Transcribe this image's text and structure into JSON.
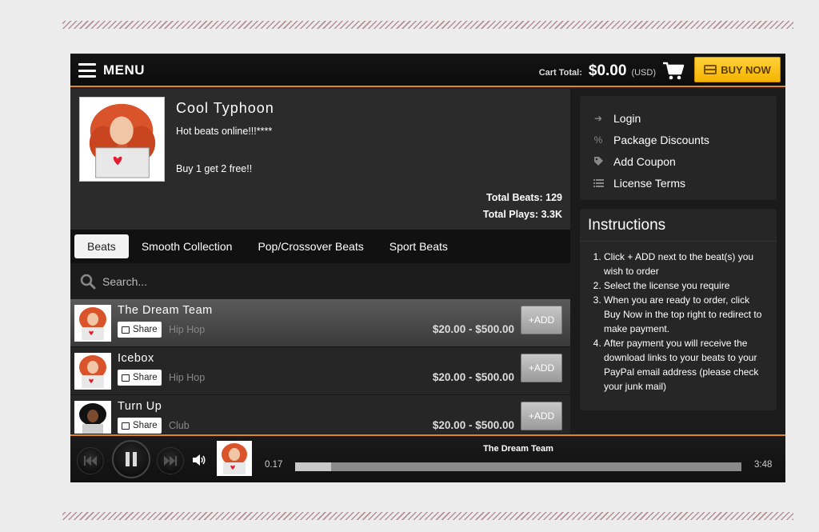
{
  "header": {
    "menu_label": "MENU",
    "cart_total_label": "Cart Total:",
    "cart_total_amount": "$0.00",
    "cart_currency": "(USD)",
    "buy_now_label": "BUY NOW",
    "accent_color": "#e0861e"
  },
  "profile": {
    "name": "Cool Typhoon",
    "bio_line1": "Hot beats online!!!****",
    "bio_line2": "Buy 1 get 2 free!!",
    "total_beats": "Total Beats: 129",
    "total_plays": "Total Plays: 3.3K"
  },
  "tabs": [
    {
      "label": "Beats",
      "active": true
    },
    {
      "label": "Smooth Collection",
      "active": false
    },
    {
      "label": "Pop/Crossover Beats",
      "active": false
    },
    {
      "label": "Sport Beats",
      "active": false
    }
  ],
  "search": {
    "placeholder": "Search..."
  },
  "tracks": [
    {
      "title": "The Dream Team",
      "share_label": "Share",
      "genre": "Hip Hop",
      "price": "$20.00 - $500.00",
      "add_label": "+ADD",
      "active": true
    },
    {
      "title": "Icebox",
      "share_label": "Share",
      "genre": "Hip Hop",
      "price": "$20.00 - $500.00",
      "add_label": "+ADD",
      "active": false
    },
    {
      "title": "Turn Up",
      "share_label": "Share",
      "genre": "Club",
      "price": "$20.00 - $500.00",
      "add_label": "+ADD",
      "active": false
    }
  ],
  "links": [
    {
      "label": "Login",
      "icon": "sign-in-icon"
    },
    {
      "label": "Package Discounts",
      "icon": "percent-icon"
    },
    {
      "label": "Add Coupon",
      "icon": "tag-icon"
    },
    {
      "label": "License Terms",
      "icon": "list-icon"
    }
  ],
  "instructions": {
    "title": "Instructions",
    "steps": [
      "Click + ADD next to the beat(s) you wish to order",
      "Select the license you require",
      "When you are ready to order, click Buy Now in the top right to redirect to make payment.",
      "After payment you will receive the download links to your beats to your PayPal email address (please check your junk mail)"
    ]
  },
  "player": {
    "now_playing": "The Dream Team",
    "current_time": "0.17",
    "total_time": "3:48",
    "progress": 0.08
  }
}
